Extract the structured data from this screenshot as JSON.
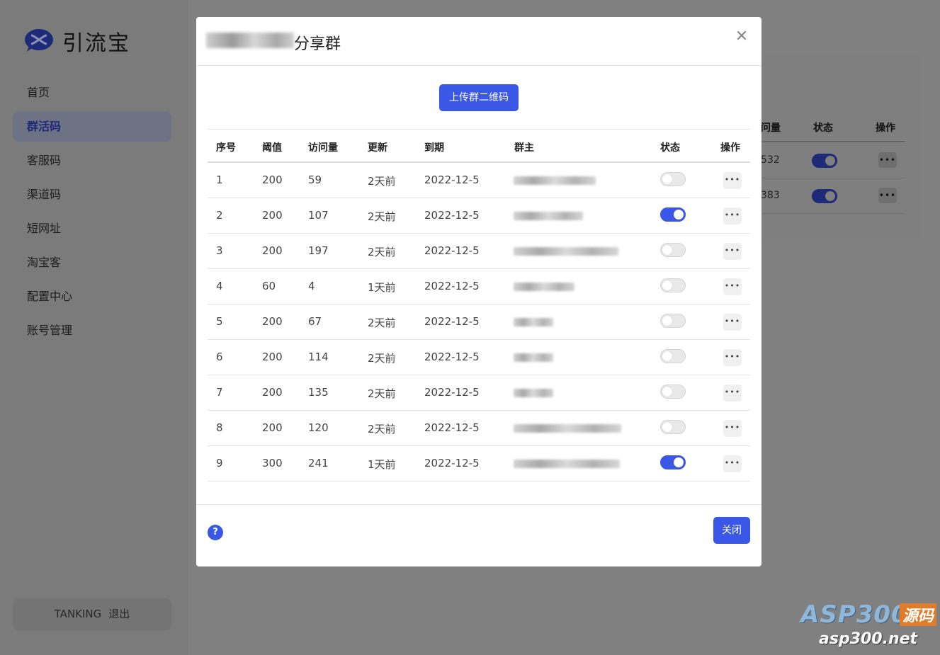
{
  "app": {
    "name": "引流宝"
  },
  "sidebar": {
    "items": [
      {
        "label": "首页"
      },
      {
        "label": "群活码",
        "active": true
      },
      {
        "label": "客服码"
      },
      {
        "label": "渠道码"
      },
      {
        "label": "短网址"
      },
      {
        "label": "淘宝客"
      },
      {
        "label": "配置中心"
      },
      {
        "label": "账号管理"
      }
    ],
    "user": "TANKING",
    "logout_label": "退出"
  },
  "background_table": {
    "headers": [
      "问量",
      "状态",
      "操作"
    ],
    "rows": [
      {
        "visits": "532",
        "status_on": true
      },
      {
        "visits": "383",
        "status_on": true
      }
    ]
  },
  "modal": {
    "title": "分享群",
    "upload_button": "上传群二维码",
    "close_button": "关闭",
    "headers": [
      "序号",
      "阈值",
      "访问量",
      "更新",
      "到期",
      "群主",
      "状态",
      "操作"
    ],
    "rows": [
      {
        "idx": "1",
        "threshold": "200",
        "visits": "59",
        "updated": "2天前",
        "expires": "2022-12-5",
        "status_on": false
      },
      {
        "idx": "2",
        "threshold": "200",
        "visits": "107",
        "updated": "2天前",
        "expires": "2022-12-5",
        "status_on": true
      },
      {
        "idx": "3",
        "threshold": "200",
        "visits": "197",
        "updated": "2天前",
        "expires": "2022-12-5",
        "status_on": false
      },
      {
        "idx": "4",
        "threshold": "60",
        "visits": "4",
        "updated": "1天前",
        "expires": "2022-12-5",
        "status_on": false
      },
      {
        "idx": "5",
        "threshold": "200",
        "visits": "67",
        "updated": "2天前",
        "expires": "2022-12-5",
        "status_on": false
      },
      {
        "idx": "6",
        "threshold": "200",
        "visits": "114",
        "updated": "2天前",
        "expires": "2022-12-5",
        "status_on": false
      },
      {
        "idx": "7",
        "threshold": "200",
        "visits": "135",
        "updated": "2天前",
        "expires": "2022-12-5",
        "status_on": false
      },
      {
        "idx": "8",
        "threshold": "200",
        "visits": "120",
        "updated": "2天前",
        "expires": "2022-12-5",
        "status_on": false
      },
      {
        "idx": "9",
        "threshold": "300",
        "visits": "241",
        "updated": "1天前",
        "expires": "2022-12-5",
        "status_on": true
      }
    ]
  },
  "watermark": {
    "brand": "ASP300",
    "tag": "源码",
    "site": "asp300.net"
  },
  "colors": {
    "accent": "#3a57e8",
    "overlay": "#808080"
  },
  "icons": {
    "close": "close-icon",
    "more": "more-icon",
    "help": "help-icon",
    "logo": "logo-icon"
  }
}
